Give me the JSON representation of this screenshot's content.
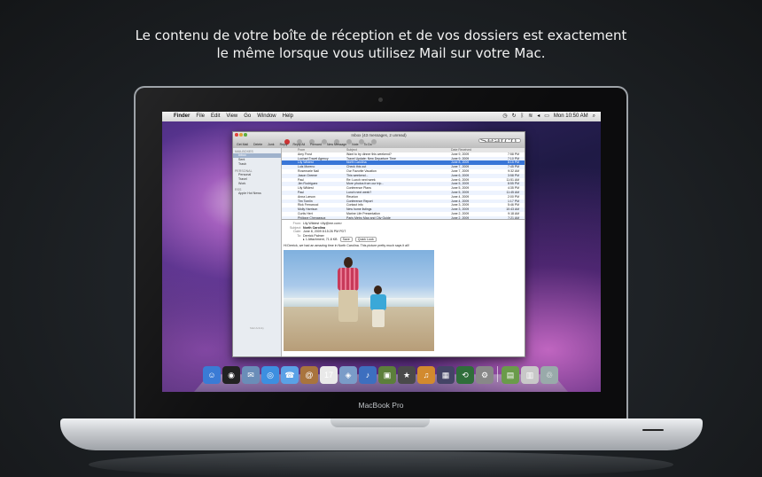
{
  "headline": {
    "line1": "Le contenu de votre boîte de réception et de vos dossiers est exactement",
    "line2": "le même lorsque vous utilisez Mail sur votre Mac."
  },
  "laptop": {
    "brand": "MacBook Pro"
  },
  "menubar": {
    "apple": "",
    "app": "Finder",
    "items": [
      "File",
      "Edit",
      "View",
      "Go",
      "Window",
      "Help"
    ],
    "clock": "Mon 10:50 AM",
    "status_icons": [
      "time-machine-icon",
      "sync-icon",
      "bluetooth-icon",
      "wifi-icon",
      "volume-icon",
      "battery-icon",
      "spotlight-icon"
    ]
  },
  "mail": {
    "title": "Inbox (43 messages, 2 unread)",
    "toolbar": [
      "Get Mail",
      "Delete",
      "Junk",
      "Reply",
      "Reply All",
      "Forward",
      "New Message",
      "Note",
      "To Do"
    ],
    "search_placeholder": "Search",
    "sidebar": {
      "mailboxes_header": "Mailboxes",
      "mailboxes": [
        "Inbox",
        "Sent",
        "Trash"
      ],
      "personal_header": "Personal",
      "personal": [
        "Personal",
        "Travel",
        "Work"
      ],
      "rss_header": "RSS",
      "rss": [
        "Apple Hot News"
      ],
      "activity": "Mail Activity"
    },
    "columns": [
      "From",
      "Subject",
      "Date Received"
    ],
    "messages": [
      {
        "from": "Amy Frost",
        "subject": "Want to try dinner this weekend?",
        "date": "June 9, 2009",
        "time": "7:58 PM"
      },
      {
        "from": "Lochart Travel Agency",
        "subject": "Travel Update: New Departure Time",
        "date": "June 9, 2009",
        "time": "7:10 PM"
      },
      {
        "from": "Lily Wildest",
        "subject": "North Carolina",
        "date": "June 8, 2009",
        "time": "8:15 PM"
      },
      {
        "from": "Luis Moreno",
        "subject": "Check this out",
        "date": "June 7, 2009",
        "time": "7:45 PM"
      },
      {
        "from": "Rosemarie Nail",
        "subject": "Our Favorite Vacation",
        "date": "June 7, 2009",
        "time": "9:32 AM"
      },
      {
        "from": "Jason Greene",
        "subject": "This weekend...",
        "date": "June 6, 2009",
        "time": "3:58 PM"
      },
      {
        "from": "Paul",
        "subject": "Re: Lunch next week",
        "date": "June 6, 2009",
        "time": "11:51 AM"
      },
      {
        "from": "Jim Rodriguez",
        "subject": "More photos from our trip...",
        "date": "June 5, 2009",
        "time": "8:55 PM"
      },
      {
        "from": "Lily Wildest",
        "subject": "Conference Plans",
        "date": "June 5, 2009",
        "time": "4:35 PM"
      },
      {
        "from": "Paul",
        "subject": "Lunch next week?",
        "date": "June 5, 2009",
        "time": "11:45 AM"
      },
      {
        "from": "Anna Larson",
        "subject": "Reunion",
        "date": "June 4, 2009",
        "time": "2:00 PM"
      },
      {
        "from": "Tim Tomlin",
        "subject": "Conference Report",
        "date": "June 4, 2009",
        "time": "1:17 PM"
      },
      {
        "from": "Rick Fernwood",
        "subject": "Contact info",
        "date": "June 3, 2009",
        "time": "5:46 PM"
      },
      {
        "from": "Molly Harrison",
        "subject": "New home listings",
        "date": "June 3, 2009",
        "time": "10:43 AM"
      },
      {
        "from": "Curtis Hert",
        "subject": "Marine Life Presentation",
        "date": "June 2, 2009",
        "time": "9:18 AM"
      },
      {
        "from": "Philippe Chenaeaux",
        "subject": "Paris Metro Map and City Guide",
        "date": "June 2, 2009",
        "time": "7:21 AM"
      }
    ],
    "preview": {
      "from_label": "From:",
      "from": "Lily Wildest <lily@me.com>",
      "subject_label": "Subject:",
      "subject": "North Carolina",
      "date_label": "Date:",
      "date": "June 8, 2009 8:15:26 PM PDT",
      "to_label": "To:",
      "to": "Derrick Palmer",
      "attachments": "1 Attachment, 71.8 KB",
      "save_label": "Save",
      "quicklook_label": "Quick Look",
      "body": "Hi Derrick, we had an amazing time in North Carolina. This picture pretty much says it all!"
    }
  },
  "dock": {
    "apps": [
      {
        "name": "finder-icon",
        "glyph": "☺",
        "color": "#3a7bd5"
      },
      {
        "name": "dashboard-icon",
        "glyph": "◉",
        "color": "#222"
      },
      {
        "name": "mail-icon",
        "glyph": "✉",
        "color": "#6a8db8"
      },
      {
        "name": "safari-icon",
        "glyph": "◎",
        "color": "#3d8fe0"
      },
      {
        "name": "ichat-icon",
        "glyph": "☎",
        "color": "#5aa1e6"
      },
      {
        "name": "address-book-icon",
        "glyph": "@",
        "color": "#a9743d"
      },
      {
        "name": "ical-icon",
        "glyph": "17",
        "color": "#e9e9e9"
      },
      {
        "name": "preview-icon",
        "glyph": "◈",
        "color": "#7a9cc8"
      },
      {
        "name": "itunes-icon",
        "glyph": "♪",
        "color": "#3d6fbf"
      },
      {
        "name": "iphoto-icon",
        "glyph": "▣",
        "color": "#5c7f3b"
      },
      {
        "name": "imovie-icon",
        "glyph": "★",
        "color": "#4a4a4a"
      },
      {
        "name": "garageband-icon",
        "glyph": "♫",
        "color": "#d28a2e"
      },
      {
        "name": "spaces-icon",
        "glyph": "▦",
        "color": "#446"
      },
      {
        "name": "time-machine-icon",
        "glyph": "⟲",
        "color": "#2f6e3a"
      },
      {
        "name": "system-preferences-icon",
        "glyph": "⚙",
        "color": "#888"
      }
    ],
    "stacks": [
      {
        "name": "photo-stack-icon",
        "glyph": "▤",
        "color": "#6a9b4a"
      },
      {
        "name": "documents-stack-icon",
        "glyph": "▥",
        "color": "#c8c8c8"
      },
      {
        "name": "trash-icon",
        "glyph": "♲",
        "color": "#9aa"
      }
    ]
  }
}
